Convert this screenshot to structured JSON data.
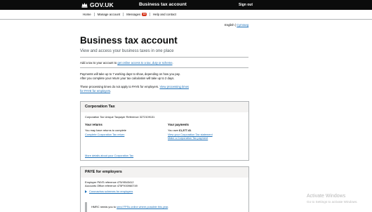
{
  "header": {
    "brand": "GOV.UK",
    "service_name": "Business tax account",
    "sign_out": "Sign out"
  },
  "nav": {
    "items": [
      {
        "label": "Home"
      },
      {
        "label": "Manage account"
      },
      {
        "label": "Messages",
        "badge": "10"
      },
      {
        "label": "Help and contact"
      }
    ]
  },
  "language": {
    "current": "English",
    "separator": "|",
    "other": "Cymraeg"
  },
  "page": {
    "title": "Business tax account",
    "subtitle": "View and access your business taxes in one place"
  },
  "add_tax": {
    "prefix": "Add a tax to your account to ",
    "link": "get online access to a tax, duty or scheme",
    "suffix": "."
  },
  "processing": {
    "line1": "Payments will take up to 7 working days to show, depending on how you pay.",
    "line2": "After you complete your return your tax calculation will take up to 2 days.",
    "paye_prefix": "These processing times do not apply to PAYE for employers. ",
    "paye_link": "View processing times for PAYE for employers",
    "paye_suffix": "."
  },
  "corporation_tax": {
    "title": "Corporation Tax",
    "utr": "Corporation Tax Unique Taxpayer Reference 3272109131",
    "returns_heading": "Your returns",
    "returns_text": "You may have returns to complete",
    "returns_link": "Complete Corporation Tax return",
    "payments_heading": "Your payments",
    "payments_text_prefix": "You owe ",
    "payments_amount": "£1,377.41",
    "payments_text_suffix": ".",
    "payments_link1": "View your Corporation Tax statement",
    "payments_link2": "Make a Corporation Tax payment",
    "more_link": "More details about your Corporation Tax"
  },
  "paye": {
    "title": "PAYE for employers",
    "employer_ref": "Employer PAYE reference 475/XB43412",
    "accounts_ref": "Accounts Office reference 475PX00960749",
    "coronavirus_link": "Coronavirus schemes for employers",
    "inset_prefix": "HMRC needs you to ",
    "inset_link": "send FPSs online where possible this year",
    "inset_suffix": "."
  },
  "watermark": {
    "title": "Activate Windows",
    "subtitle": "Go to Settings to activate Windows."
  }
}
